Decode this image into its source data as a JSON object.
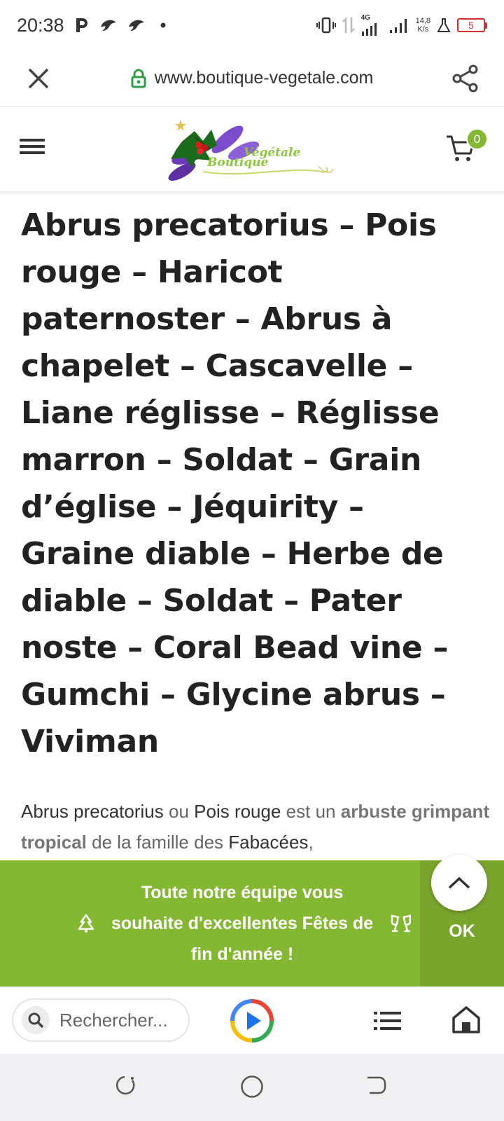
{
  "status_bar": {
    "time": "20:38",
    "left_icons": [
      "parking-icon",
      "bird-icon",
      "bird-icon",
      "dot-icon"
    ],
    "network_type": "4G",
    "net_speed_value": "14,8",
    "net_speed_unit": "K/s",
    "battery_level": "5"
  },
  "url_bar": {
    "url": "www.boutique-vegetale.com",
    "close_icon": "close-icon",
    "lock_icon": "lock-icon",
    "share_icon": "share-icon"
  },
  "header": {
    "logo_text_1": "Végétale",
    "logo_text_2": "Boutique",
    "cart_count": "0"
  },
  "article": {
    "title": "Abrus precatorius – Pois rouge – Haricot paternoster – Abrus à chapelet – Cascavelle – Liane réglisse – Réglisse marron – Soldat – Grain d’église – Jéquirity – Graine diable – Herbe de diable – Soldat – Pater noste – Coral Bead vine – Gumchi – Glycine abrus – Viviman",
    "intro": {
      "p1": "Abrus precatorius",
      "p2": " ou ",
      "p3": "Pois rouge",
      "p4": " est un ",
      "p5": "arbuste grimpant tropical",
      "p6": " de la famille des ",
      "p7": "Fabacées",
      "p8": ","
    }
  },
  "banner": {
    "message": "Toute notre équipe vous souhaite d'excellentes Fêtes de fin d'année !",
    "ok_label": "OK",
    "left_icon": "tree-icon",
    "right_icon": "champagne-glasses-icon"
  },
  "bottom_bar": {
    "search_placeholder": "Rechercher..."
  },
  "colors": {
    "accent_green": "#84b833",
    "ok_green": "#7aa52d",
    "lock_green": "#2e9d44",
    "battery_red": "#d32f2f"
  }
}
